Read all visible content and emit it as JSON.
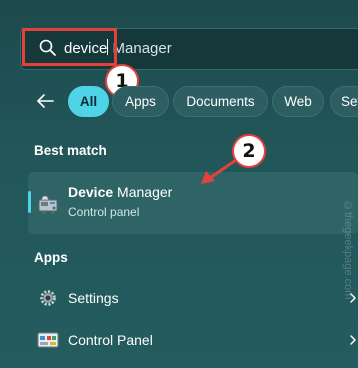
{
  "search": {
    "typed_text": "device",
    "suggestion_text": " Manager"
  },
  "annotations": {
    "step1": "1",
    "step2": "2",
    "highlight_color": "#e2423b"
  },
  "filters": {
    "back_icon": "back-arrow-icon",
    "chips": [
      {
        "label": "All",
        "active": true
      },
      {
        "label": "Apps",
        "active": false
      },
      {
        "label": "Documents",
        "active": false
      },
      {
        "label": "Web",
        "active": false
      },
      {
        "label": "Set",
        "active": false
      }
    ],
    "accent_color": "#4fd3e6"
  },
  "best_match": {
    "section_title": "Best match",
    "title_bold": "Device",
    "title_rest": " Manager",
    "subtitle": "Control panel",
    "icon": "device-manager-icon"
  },
  "apps": {
    "section_title": "Apps",
    "items": [
      {
        "label": "Settings",
        "icon": "settings-gear-icon"
      },
      {
        "label": "Control Panel",
        "icon": "control-panel-icon"
      }
    ]
  },
  "watermark": "©thegeekpage.com"
}
